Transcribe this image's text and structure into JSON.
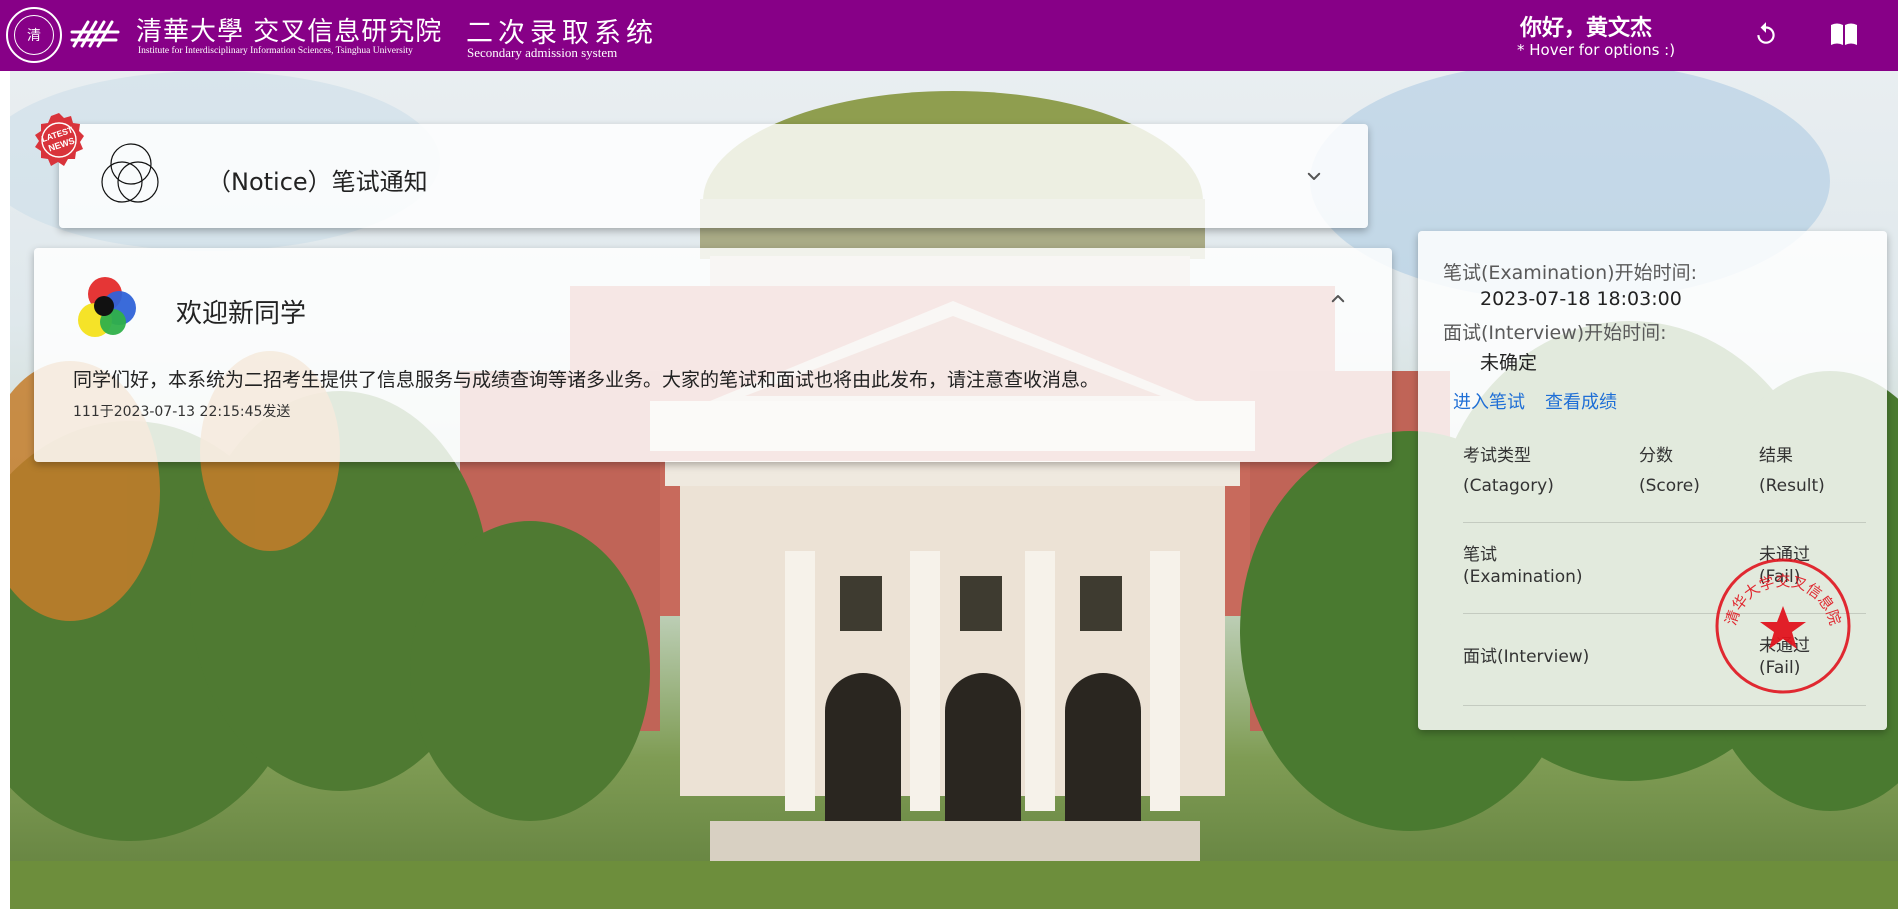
{
  "header": {
    "school_cn": "清華大學 交叉信息研究院",
    "school_en": "Institute for Interdisciplinary Information Sciences, Tsinghua University",
    "separator": "·",
    "system_cn": "二次录取系统",
    "system_en": "Secondary admission system",
    "greeting": "你好，黄文杰",
    "hint": "* Hover for options :)",
    "seal_glyph": "清",
    "logo_mark": "iiis"
  },
  "notice": {
    "badge_line1": "LATEST",
    "badge_line2": "NEWS",
    "title": "（Notice）笔试通知"
  },
  "welcome": {
    "title": "欢迎新同学",
    "body": "同学们好，本系统为二招考生提供了信息服务与成绩查询等诸多业务。大家的笔试和面试也将由此发布，请注意查收消息。",
    "meta": "111于2023-07-13 22:15:45发送"
  },
  "panel": {
    "exam_label": "笔试(Examination)开始时间:",
    "exam_time": "2023-07-18 18:03:00",
    "interview_label": "面试(Interview)开始时间:",
    "interview_time": "未确定",
    "link_exam": "进入笔试",
    "link_score": "查看成绩",
    "headers": [
      {
        "cn": "考试类型",
        "en": "(Catagory)"
      },
      {
        "cn": "分数",
        "en": "(Score)"
      },
      {
        "cn": "结果",
        "en": "(Result)"
      }
    ],
    "rows": [
      {
        "type_cn": "笔试",
        "type_en": "(Examination)",
        "score": "",
        "result_cn": "未通过",
        "result_en": "(Fail)"
      },
      {
        "type": "面试(Interview)",
        "score": "",
        "result_cn": "未通过",
        "result_en": "(Fail)"
      }
    ],
    "stamp_text": "清华大学交叉信息院"
  },
  "colors": {
    "header_bg": "#870087",
    "link": "#1f6fd6",
    "stamp_red": "#e0141e"
  },
  "icons": {
    "refresh": "refresh-icon",
    "book": "book-icon",
    "rings": "rings-icon",
    "rgb": "rgb-circles-icon",
    "chevron_down": "chevron-down-icon",
    "chevron_up": "chevron-up-icon"
  }
}
